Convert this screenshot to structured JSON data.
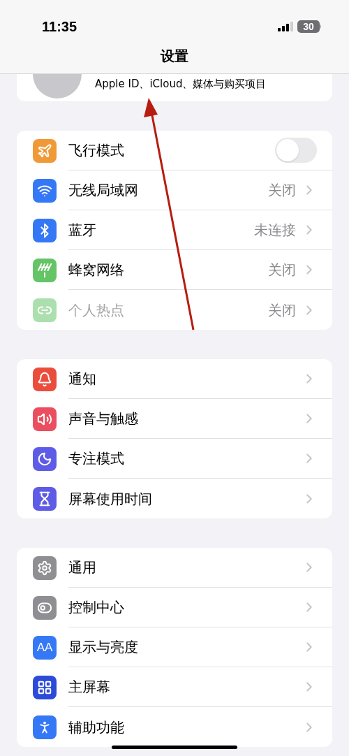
{
  "status_bar": {
    "time": "11:35",
    "battery": "30"
  },
  "header": {
    "title": "设置"
  },
  "profile": {
    "subtitle": "Apple ID、iCloud、媒体与购买项目"
  },
  "groups": [
    {
      "items": [
        {
          "kind": "toggle",
          "label": "飞行模式",
          "on": false,
          "disabled": false,
          "color": "#f09a37"
        },
        {
          "kind": "link",
          "label": "无线局域网",
          "value": "关闭",
          "disabled": false,
          "color": "#3478f6"
        },
        {
          "kind": "link",
          "label": "蓝牙",
          "value": "未连接",
          "disabled": false,
          "color": "#3478f6"
        },
        {
          "kind": "link",
          "label": "蜂窝网络",
          "value": "关闭",
          "disabled": false,
          "color": "#65c466"
        },
        {
          "kind": "link",
          "label": "个人热点",
          "value": "关闭",
          "disabled": true,
          "color": "#acdfae"
        }
      ]
    },
    {
      "items": [
        {
          "kind": "link",
          "label": "通知",
          "disabled": false,
          "color": "#eb4d3d"
        },
        {
          "kind": "link",
          "label": "声音与触感",
          "disabled": false,
          "color": "#eb4e5e"
        },
        {
          "kind": "link",
          "label": "专注模式",
          "disabled": false,
          "color": "#5e5ce6"
        },
        {
          "kind": "link",
          "label": "屏幕使用时间",
          "disabled": false,
          "color": "#5e5ce6"
        }
      ]
    },
    {
      "items": [
        {
          "kind": "link",
          "label": "通用",
          "disabled": false,
          "color": "#8e8e93"
        },
        {
          "kind": "link",
          "label": "控制中心",
          "disabled": false,
          "color": "#8e8e93"
        },
        {
          "kind": "link",
          "label": "显示与亮度",
          "icon_label": "AA",
          "disabled": false,
          "color": "#3478f6"
        },
        {
          "kind": "link",
          "label": "主屏幕",
          "disabled": false,
          "color": "#2c4bd8"
        },
        {
          "kind": "link",
          "label": "辅助功能",
          "disabled": false,
          "color": "#3478f6"
        }
      ]
    }
  ]
}
